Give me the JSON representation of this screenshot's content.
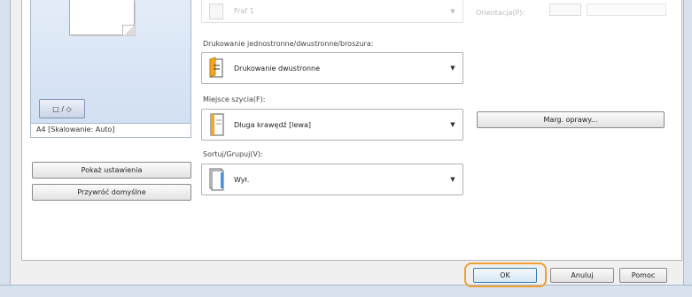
{
  "top_row": {
    "partial_value": "Fraf 1",
    "right_label": "Orientacja(P):"
  },
  "preview": {
    "caption": "A4 [Skalowanie: Auto]",
    "button_text": "□ / ◇"
  },
  "sidebar": {
    "show_settings": "Pokaż ustawienia",
    "restore_defaults": "Przywróć domyślne"
  },
  "print_mode": {
    "label": "Drukowanie jednostronne/dwustronne/broszura:",
    "value": "Drukowanie dwustronne",
    "icon": "duplex-page-icon"
  },
  "binding": {
    "label": "Miejsce szycia(F):",
    "value": "Długa krawędź [lewa]",
    "icon": "long-edge-binding-icon"
  },
  "collate": {
    "label": "Sortuj/Grupuj(V):",
    "value": "Wył.",
    "icon": "collate-off-icon"
  },
  "gutter_button": "Marg. oprawy...",
  "footer": {
    "ok": "OK",
    "cancel": "Anuluj",
    "help": "Pomoc"
  },
  "colors": {
    "highlight_ring": "#f0a030",
    "ok_border": "#3c7fb1",
    "preview_bg": "#d2e0f3"
  }
}
